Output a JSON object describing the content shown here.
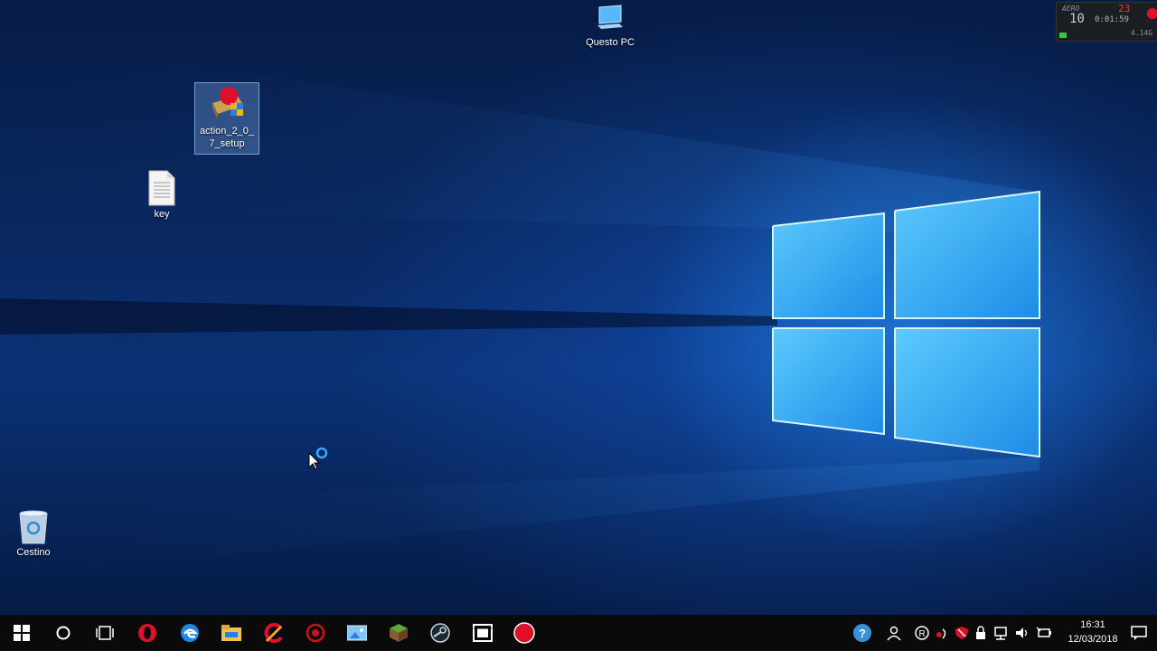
{
  "desktop": {
    "icons": {
      "this_pc": "Questo PC",
      "setup_file": "action_2_0_7_setup",
      "key_file": "key",
      "recycle_bin": "Cestino"
    }
  },
  "recorder_overlay": {
    "brand": "AERO",
    "fps": "10",
    "frame_count": "23",
    "elapsed": "0:01:59",
    "size": "4.14G"
  },
  "taskbar": {
    "apps": [
      "start-icon",
      "search-cortana-icon",
      "task-view-icon",
      "opera-icon",
      "edge-icon",
      "file-explorer-icon",
      "ccleaner-icon",
      "red-app-icon",
      "photos-icon",
      "minecraft-icon",
      "steam-icon",
      "media-app-icon",
      "record-icon"
    ],
    "clock_time": "16:31",
    "clock_date": "12/03/2018"
  },
  "colors": {
    "taskbar_bg": "#0a0a0a",
    "wallpaper_glow": "#2896ff",
    "record_red": "#e0102a"
  }
}
